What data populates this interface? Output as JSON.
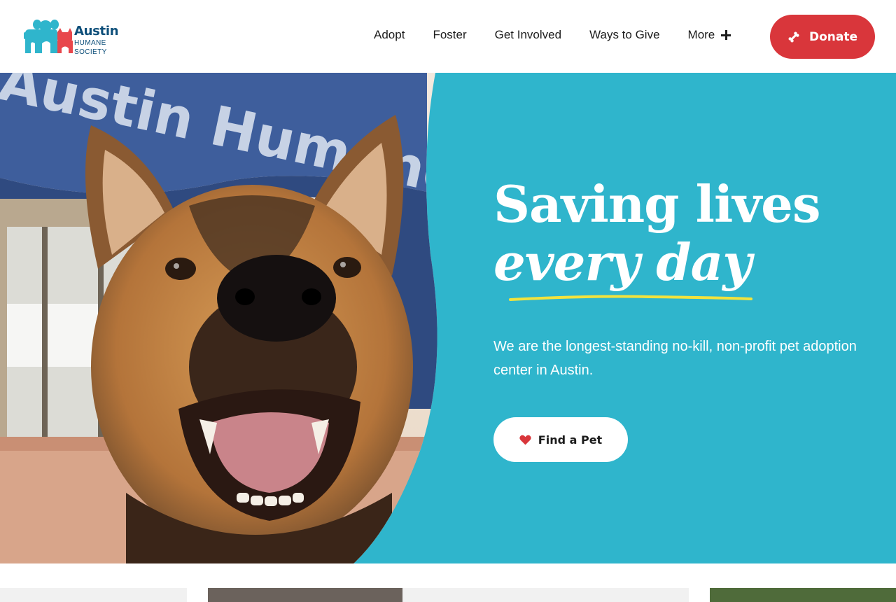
{
  "brand": {
    "name_line1": "Austin",
    "name_line2": "HUMANE",
    "name_line3": "SOCIETY",
    "color_primary": "#0d4f7a",
    "color_teal": "#2fb5cc",
    "color_red": "#d9363b",
    "color_yellow": "#f2e33d"
  },
  "nav": {
    "items": [
      {
        "label": "Adopt"
      },
      {
        "label": "Foster"
      },
      {
        "label": "Get Involved"
      },
      {
        "label": "Ways to Give"
      },
      {
        "label": "More"
      }
    ],
    "more_icon": "plus-icon",
    "donate_label": "Donate",
    "donate_icon": "bone-icon"
  },
  "hero": {
    "headline_line1": "Saving lives",
    "headline_line2": "every day",
    "description": "We are the longest-standing no-kill, non-profit pet adoption center in Austin.",
    "cta_label": "Find a Pet",
    "cta_icon": "heart-icon",
    "photo_subject": "smiling shepherd mix dog in front of shelter building",
    "building_sign_text": "Austin Humane Society"
  }
}
